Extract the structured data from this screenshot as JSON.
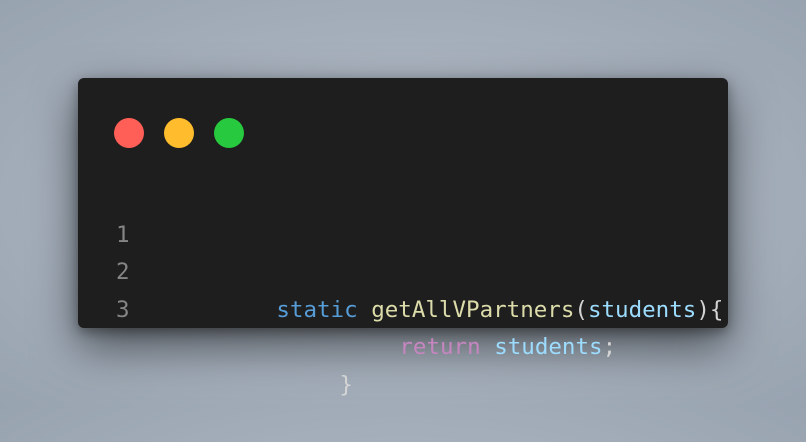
{
  "window": {
    "background": "#1e1e1e",
    "controls": [
      {
        "name": "close",
        "color": "#ff5f56"
      },
      {
        "name": "minimize",
        "color": "#ffbd2e"
      },
      {
        "name": "maximize",
        "color": "#27c93f"
      }
    ]
  },
  "code": {
    "lines": [
      {
        "number": "1",
        "tokens": [
          {
            "text": "static",
            "color": "#569cd6"
          },
          {
            "text": " ",
            "color": "#d4d4d4"
          },
          {
            "text": "getAllVPartners",
            "color": "#dcdcaa"
          },
          {
            "text": "(",
            "color": "#d4d4d4"
          },
          {
            "text": "students",
            "color": "#9cdcfe"
          },
          {
            "text": "){",
            "color": "#d4d4d4"
          }
        ]
      },
      {
        "number": "2",
        "tokens": [
          {
            "text": "return",
            "color": "#c586c0"
          },
          {
            "text": " ",
            "color": "#d4d4d4"
          },
          {
            "text": "students",
            "color": "#9cdcfe"
          },
          {
            "text": ";",
            "color": "#d4d4d4"
          }
        ]
      },
      {
        "number": "3",
        "tokens": [
          {
            "text": "}",
            "color": "#d4d4d4"
          }
        ]
      }
    ]
  }
}
